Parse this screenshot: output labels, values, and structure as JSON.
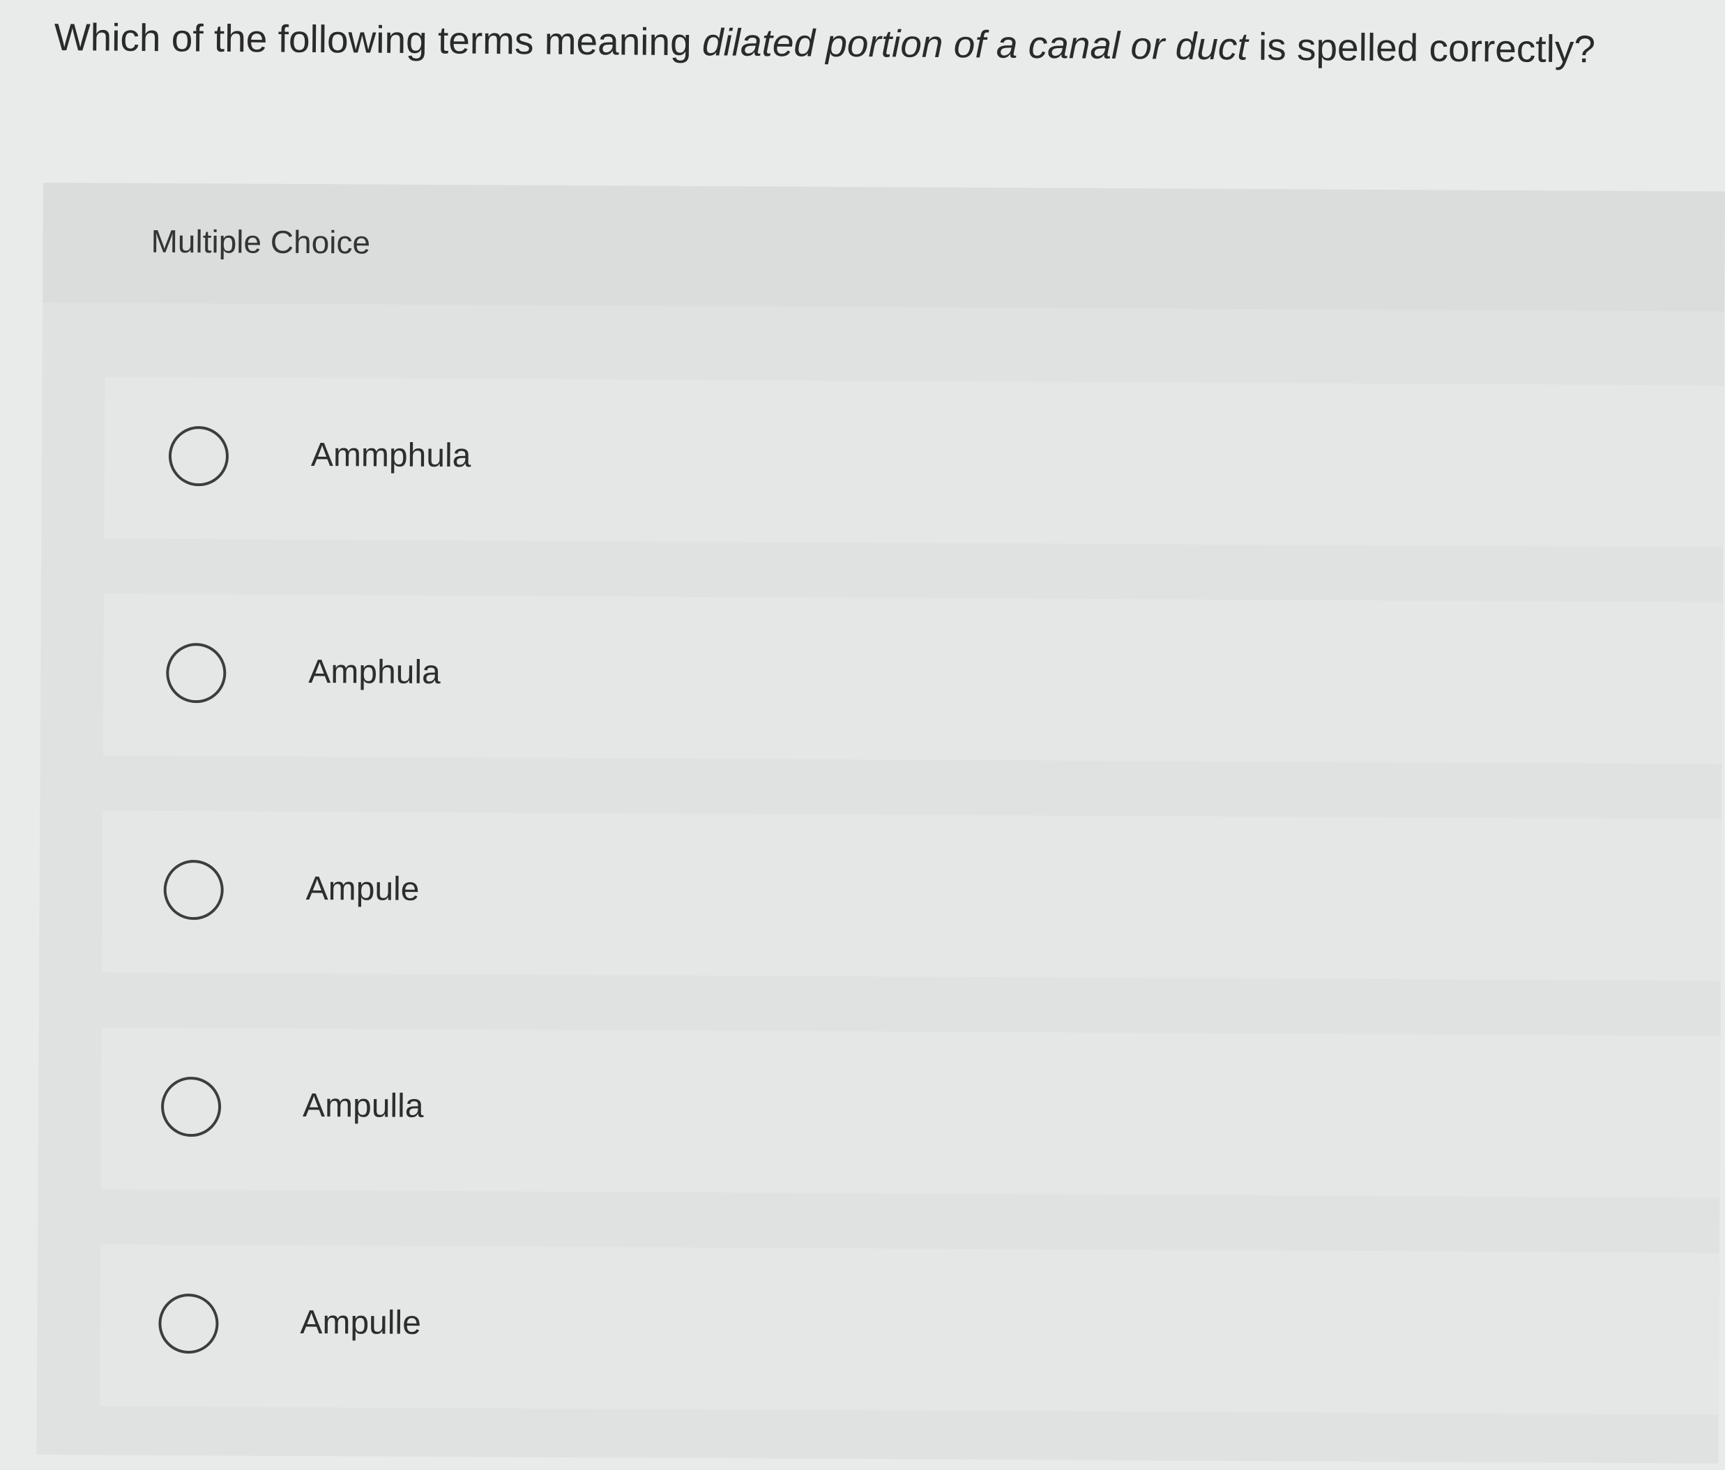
{
  "question": {
    "prefix": "Which of the following terms meaning ",
    "emphasis": "dilated portion of a canal or duct",
    "suffix": " is spelled correctly?"
  },
  "card": {
    "title": "Multiple Choice"
  },
  "choices": [
    {
      "label": "Ammphula",
      "selected": false
    },
    {
      "label": "Amphula",
      "selected": false
    },
    {
      "label": "Ampule",
      "selected": false
    },
    {
      "label": "Ampulla",
      "selected": false
    },
    {
      "label": "Ampulle",
      "selected": false
    }
  ]
}
